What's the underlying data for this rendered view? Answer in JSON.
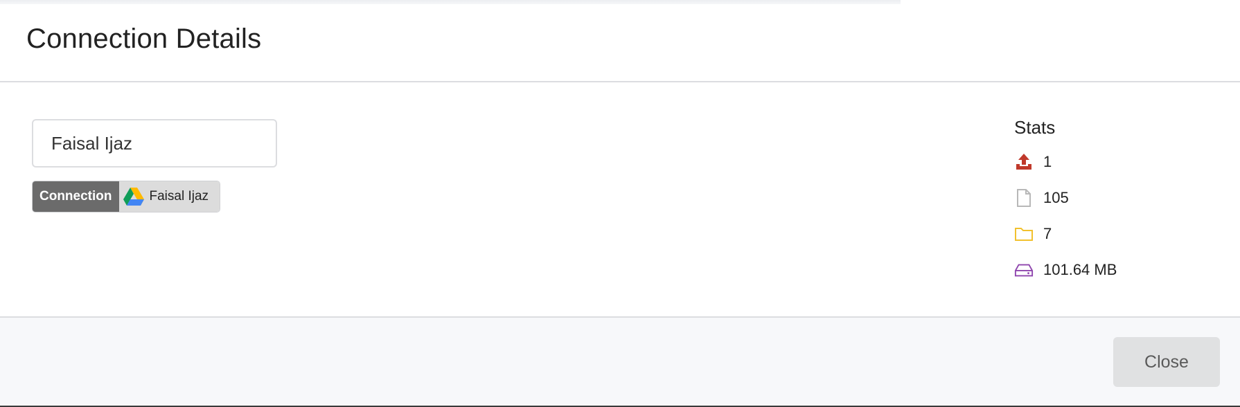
{
  "dialog": {
    "title": "Connection Details"
  },
  "connection": {
    "name_value": "Faisal Ijaz",
    "label": {
      "key": "Connection",
      "value": "Faisal Ijaz",
      "icon": "google-drive-icon"
    }
  },
  "stats": {
    "title": "Stats",
    "items": [
      {
        "icon": "upload-icon",
        "value": "1",
        "color": "#c0392b"
      },
      {
        "icon": "file-icon",
        "value": "105",
        "color": "#b8b8b8"
      },
      {
        "icon": "folder-icon",
        "value": "7",
        "color": "#f2c12e"
      },
      {
        "icon": "hard-drive-icon",
        "value": "101.64 MB",
        "color": "#8e44ad"
      }
    ]
  },
  "footer": {
    "close_label": "Close"
  }
}
